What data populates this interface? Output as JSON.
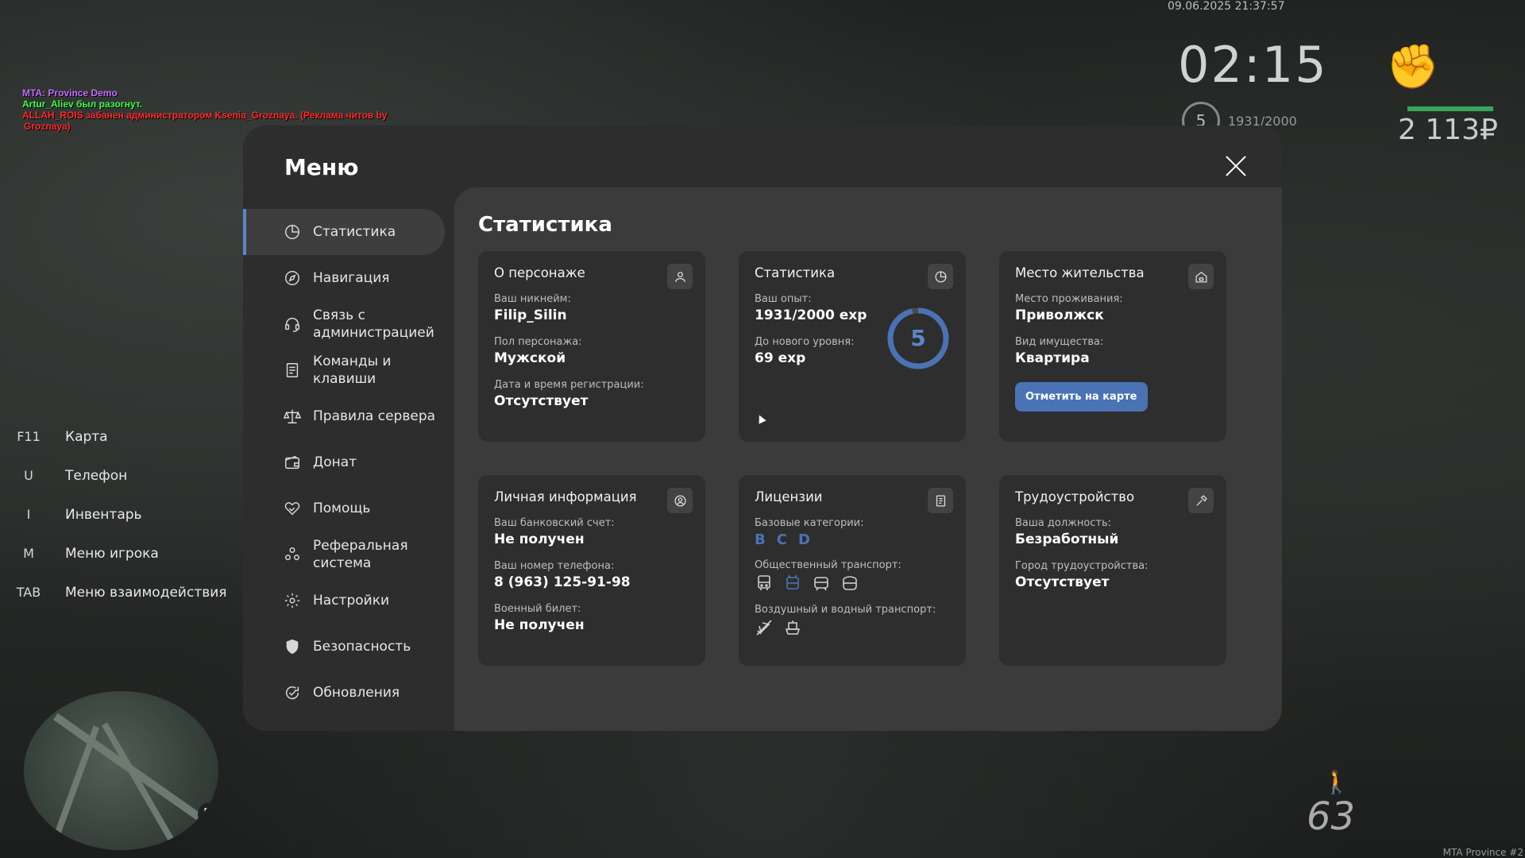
{
  "hud": {
    "datetime": "09.06.2025 21:37:57",
    "clock": "02:15",
    "level": "5",
    "exp": "1931/2000",
    "money": "2 113₽",
    "speed": "63",
    "footer": "MTA Province #2",
    "chat": [
      "MTA: Province Demo",
      "Artur_Aliev был разогнут.",
      "ALLAH_ROIS забанен администратором Ksenia_Groznaya. (Реклама читов by",
      "Groznaya)"
    ],
    "hotkeys": [
      {
        "key": "F11",
        "label": "Карта"
      },
      {
        "key": "U",
        "label": "Телефон"
      },
      {
        "key": "I",
        "label": "Инвентарь"
      },
      {
        "key": "M",
        "label": "Меню игрока"
      },
      {
        "key": "TAB",
        "label": "Меню взаимодействия"
      }
    ],
    "minimap_north": "N"
  },
  "menu": {
    "title": "Меню",
    "sidebar": [
      {
        "label": "Статистика",
        "icon": "pie-chart-icon",
        "active": true
      },
      {
        "label": "Навигация",
        "icon": "compass-icon"
      },
      {
        "label": "Связь с администрацией",
        "icon": "headset-icon"
      },
      {
        "label": "Команды и клавиши",
        "icon": "document-icon"
      },
      {
        "label": "Правила сервера",
        "icon": "scales-icon"
      },
      {
        "label": "Донат",
        "icon": "wallet-icon"
      },
      {
        "label": "Помощь",
        "icon": "handshake-heart-icon"
      },
      {
        "label": "Реферальная система",
        "icon": "people-icon"
      },
      {
        "label": "Настройки",
        "icon": "gear-icon"
      },
      {
        "label": "Безопасность",
        "icon": "shield-icon"
      },
      {
        "label": "Обновления",
        "icon": "refresh-check-icon"
      }
    ],
    "section_title": "Статистика",
    "accent": "#4a73b6",
    "cards": {
      "character": {
        "title": "О персонаже",
        "icon": "person-icon",
        "nick_label": "Ваш никнейм:",
        "nick": "Filip_Silin",
        "gender_label": "Пол персонажа:",
        "gender": "Мужской",
        "reg_label": "Дата и время регистрации:",
        "reg": "Отсутствует"
      },
      "stats": {
        "title": "Статистика",
        "icon": "pie-chart-icon",
        "exp_label": "Ваш опыт:",
        "exp": "1931/2000 exp",
        "next_label": "До нового уровня:",
        "next": "69 exp",
        "level": "5",
        "progress": 0.9655
      },
      "residence": {
        "title": "Место жительства",
        "icon": "house-icon",
        "place_label": "Место проживания:",
        "place": "Приволжск",
        "type_label": "Вид имущества:",
        "type": "Квартира",
        "button": "Отметить на карте"
      },
      "personal": {
        "title": "Личная информация",
        "icon": "user-circle-icon",
        "bank_label": "Ваш банковский счет:",
        "bank": "Не получен",
        "phone_label": "Ваш номер телефона:",
        "phone": "8 (963) 125-91-98",
        "military_label": "Военный билет:",
        "military": "Не получен"
      },
      "licenses": {
        "title": "Лицензии",
        "icon": "id-card-icon",
        "base_label": "Базовые категории:",
        "categories": [
          "B",
          "C",
          "D"
        ],
        "public_label": "Общественный транспорт:",
        "public_icons": [
          "bus-icon",
          "trolleybus-icon",
          "tram-icon",
          "metro-icon"
        ],
        "air_label": "Воздушный и водный транспорт:",
        "air_icons": [
          "plane-icon",
          "boat-icon"
        ]
      },
      "job": {
        "title": "Трудоустройство",
        "icon": "hammer-icon",
        "post_label": "Ваша должность:",
        "post": "Безработный",
        "city_label": "Город трудоустройства:",
        "city": "Отсутствует"
      }
    }
  }
}
